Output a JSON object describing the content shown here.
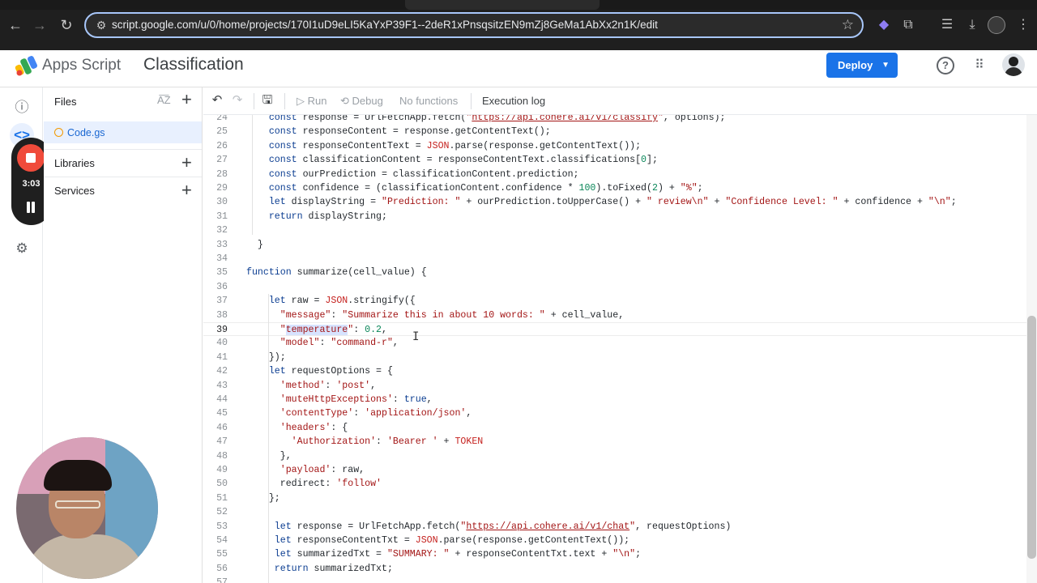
{
  "browser": {
    "url": "script.google.com/u/0/home/projects/170I1uD9eLI5KaYxP39F1--2deR1xPnsqsitzEN9mZj8GeMa1AbXx2n1K/edit"
  },
  "header": {
    "app_name": "Apps Script",
    "project_title": "Classification",
    "deploy_label": "Deploy"
  },
  "recorder": {
    "time": "3:03"
  },
  "files_panel": {
    "title": "Files",
    "file": "Code.gs",
    "sections": [
      "Libraries",
      "Services"
    ]
  },
  "toolbar": {
    "run": "Run",
    "debug": "Debug",
    "functions": "No functions",
    "execution_log": "Execution log"
  },
  "editor": {
    "current_line": 39,
    "lines": [
      {
        "n": "24",
        "t": "    const response = UrlFetchApp.fetch(\"https://api.cohere.ai/v1/classify\", options);"
      },
      {
        "n": "25",
        "t": "    const responseContent = response.getContentText();"
      },
      {
        "n": "26",
        "t": "    const responseContentText = JSON.parse(response.getContentText());"
      },
      {
        "n": "27",
        "t": "    const classificationContent = responseContentText.classifications[0];"
      },
      {
        "n": "28",
        "t": "    const ourPrediction = classificationContent.prediction;"
      },
      {
        "n": "29",
        "t": "    const confidence = (classificationContent.confidence * 100).toFixed(2) + \"%\";"
      },
      {
        "n": "30",
        "t": "    let displayString = \"Prediction: \" + ourPrediction.toUpperCase() + \" review\\n\" + \"Confidence Level: \" + confidence + \"\\n\";"
      },
      {
        "n": "31",
        "t": "    return displayString;"
      },
      {
        "n": "32",
        "t": ""
      },
      {
        "n": "33",
        "t": "  }"
      },
      {
        "n": "34",
        "t": ""
      },
      {
        "n": "35",
        "t": "function summarize(cell_value) {"
      },
      {
        "n": "36",
        "t": ""
      },
      {
        "n": "37",
        "t": "    let raw = JSON.stringify({"
      },
      {
        "n": "38",
        "t": "      \"message\": \"Summarize this in about 10 words: \" + cell_value,"
      },
      {
        "n": "39",
        "t": "      \"temperature\": 0.2,"
      },
      {
        "n": "40",
        "t": "      \"model\": \"command-r\","
      },
      {
        "n": "41",
        "t": "    });"
      },
      {
        "n": "42",
        "t": "    let requestOptions = {"
      },
      {
        "n": "43",
        "t": "      'method': 'post',"
      },
      {
        "n": "44",
        "t": "      'muteHttpExceptions': true,"
      },
      {
        "n": "45",
        "t": "      'contentType': 'application/json',"
      },
      {
        "n": "46",
        "t": "      'headers': {"
      },
      {
        "n": "47",
        "t": "        'Authorization': 'Bearer ' + TOKEN"
      },
      {
        "n": "48",
        "t": "      },"
      },
      {
        "n": "49",
        "t": "      'payload': raw,"
      },
      {
        "n": "50",
        "t": "      redirect: 'follow'"
      },
      {
        "n": "51",
        "t": "    };"
      },
      {
        "n": "52",
        "t": ""
      },
      {
        "n": "53",
        "t": "     let response = UrlFetchApp.fetch(\"https://api.cohere.ai/v1/chat\", requestOptions)"
      },
      {
        "n": "54",
        "t": "     let responseContentTxt = JSON.parse(response.getContentText());"
      },
      {
        "n": "55",
        "t": "     let summarizedTxt = \"SUMMARY: \" + responseContentTxt.text + \"\\n\";"
      },
      {
        "n": "56",
        "t": "     return summarizedTxt;"
      },
      {
        "n": "57",
        "t": ""
      }
    ]
  },
  "colors": {
    "accent": "#1a73e8",
    "string": "#a31515",
    "number": "#098658",
    "keyword": "#0b3d91",
    "record": "#f04b3b"
  }
}
